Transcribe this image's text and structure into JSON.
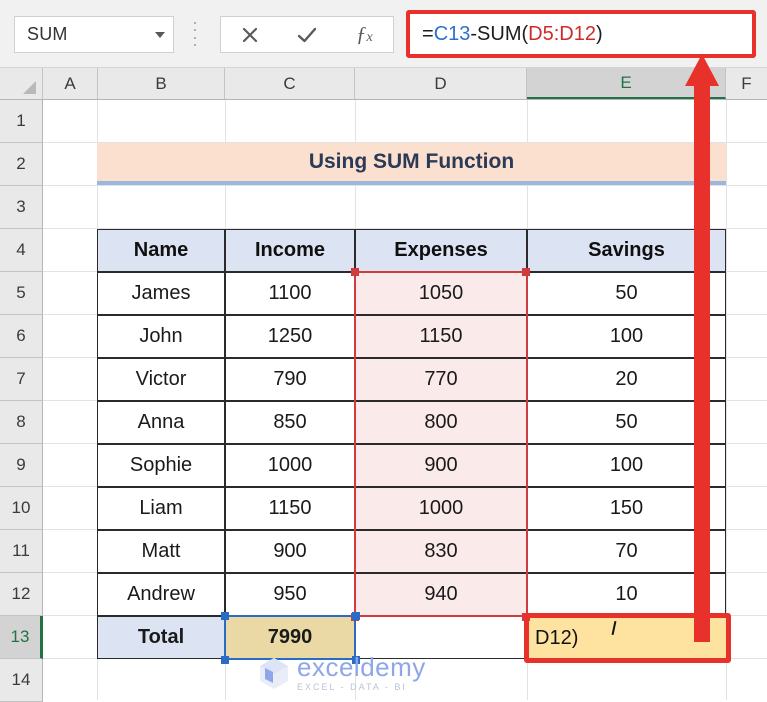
{
  "formula_bar": {
    "name_box_value": "SUM",
    "cancel_icon": "x-icon",
    "confirm_icon": "check-icon",
    "function_icon": "fx-icon",
    "formula_prefix": "=",
    "formula_ref1": "C13",
    "formula_operator": "-SUM(",
    "formula_ref2": "D5:D12",
    "formula_suffix": ")",
    "formula_full": "=C13-SUM(D5:D12)",
    "accent_color": "#e8312a",
    "ref1_color": "#2f6fd0",
    "ref2_color": "#d02b2b"
  },
  "columns": [
    {
      "label": "A",
      "active": false
    },
    {
      "label": "B",
      "active": false
    },
    {
      "label": "C",
      "active": false
    },
    {
      "label": "D",
      "active": false
    },
    {
      "label": "E",
      "active": true
    },
    {
      "label": "F",
      "active": false
    }
  ],
  "rows": [
    {
      "label": "1",
      "active": false
    },
    {
      "label": "2",
      "active": false
    },
    {
      "label": "3",
      "active": false
    },
    {
      "label": "4",
      "active": false
    },
    {
      "label": "5",
      "active": false
    },
    {
      "label": "6",
      "active": false
    },
    {
      "label": "7",
      "active": false
    },
    {
      "label": "8",
      "active": false
    },
    {
      "label": "9",
      "active": false
    },
    {
      "label": "10",
      "active": false
    },
    {
      "label": "11",
      "active": false
    },
    {
      "label": "12",
      "active": false
    },
    {
      "label": "13",
      "active": true
    },
    {
      "label": "14",
      "active": false
    }
  ],
  "sheet": {
    "title": "Using SUM Function",
    "headers": [
      "Name",
      "Income",
      "Expenses",
      "Savings"
    ],
    "data": [
      {
        "name": "James",
        "income": "1100",
        "expenses": "1050",
        "savings": "50"
      },
      {
        "name": "John",
        "income": "1250",
        "expenses": "1150",
        "savings": "100"
      },
      {
        "name": "Victor",
        "income": "790",
        "expenses": "770",
        "savings": "20"
      },
      {
        "name": "Anna",
        "income": "850",
        "expenses": "800",
        "savings": "50"
      },
      {
        "name": "Sophie",
        "income": "1000",
        "expenses": "900",
        "savings": "100"
      },
      {
        "name": "Liam",
        "income": "1150",
        "expenses": "1000",
        "savings": "150"
      },
      {
        "name": "Matt",
        "income": "900",
        "expenses": "830",
        "savings": "70"
      },
      {
        "name": "Andrew",
        "income": "950",
        "expenses": "940",
        "savings": "10"
      }
    ],
    "total": {
      "label": "Total",
      "income": "7990",
      "expenses": "",
      "savings_editing_text": "D12)"
    },
    "title_bg": "#fbe0d0",
    "header_bg": "#dce3f2",
    "expense_range_bg": "#fbeaea",
    "total_income_bg": "#ebd9a5",
    "editing_cell_bg": "#fde2a0"
  },
  "selection": {
    "blue_reference": "C13",
    "red_reference": "D5:D12",
    "blue_color": "#2a6bc6",
    "red_color": "#d23b3b"
  },
  "annotation": {
    "arrow_color": "#e8312a",
    "arrow_from": "E13",
    "arrow_to": "formula-bar"
  },
  "watermark": {
    "name": "exceldemy",
    "tagline": "EXCEL - DATA - BI"
  }
}
